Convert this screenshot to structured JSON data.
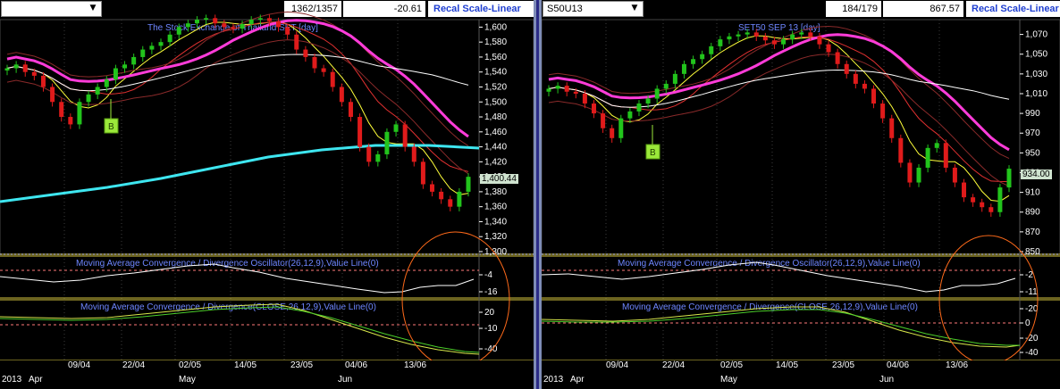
{
  "panes": [
    {
      "header": {
        "symbol": "",
        "ratio": "1362/1357",
        "change": "-20.61",
        "recal_label": "Recal Scale-Linear"
      },
      "price_title": "The Stock Exchange of Thailand SET [day]",
      "macd_osc_title": "Moving Average Convergence / Divergence Oscillator(26,12,9),Value Line(0)",
      "macd_title": "Moving Average Convergence / Divergence(CLOSE,26,12,9),Value Line(0)",
      "last_price": "1,400.44",
      "marker": "B",
      "price_ticks": [
        "1,600",
        "1,580",
        "1,560",
        "1,540",
        "1,520",
        "1,500",
        "1,480",
        "1,460",
        "1,440",
        "1,420",
        "1,400",
        "1,380",
        "1,360",
        "1,340",
        "1,320",
        "1,300"
      ],
      "osc_ticks": [
        "-4",
        "-16"
      ],
      "macd_ticks": [
        "20",
        "-10",
        "-40"
      ],
      "date_labels": [
        "09/04",
        "22/04",
        "02/05",
        "14/05",
        "23/05",
        "04/06",
        "13/06"
      ],
      "month_labels": [
        "2013",
        "Apr",
        "May",
        "Jun"
      ]
    },
    {
      "header": {
        "symbol": "S50U13",
        "ratio": "184/179",
        "change": "867.57",
        "recal_label": "Recal Scale-Linear"
      },
      "price_title": "SET50 SEP 13 [day]",
      "macd_osc_title": "Moving Average Convergence / Divergence Oscillator(26,12,9),Value Line(0)",
      "macd_title": "Moving Average Convergence / Divergence(CLOSE,26,12,9),Value Line(0)",
      "last_price": "934.00",
      "marker": "B",
      "price_ticks": [
        "1,070",
        "1,050",
        "1,030",
        "1,010",
        "990",
        "970",
        "950",
        "930",
        "910",
        "890",
        "870",
        "850"
      ],
      "osc_ticks": [
        "-2",
        "-11",
        "-20"
      ],
      "macd_ticks": [
        "0",
        "-20",
        "-40"
      ],
      "date_labels": [
        "09/04",
        "22/04",
        "02/05",
        "14/05",
        "23/05",
        "04/06",
        "13/06"
      ],
      "month_labels": [
        "2013",
        "Apr",
        "May",
        "Jun"
      ]
    }
  ],
  "chart_data": [
    {
      "type": "candlestick",
      "title": "The Stock Exchange of Thailand SET [day]",
      "ylim": [
        1300,
        1610
      ],
      "closes": [
        1545,
        1550,
        1540,
        1535,
        1520,
        1500,
        1480,
        1470,
        1500,
        1510,
        1520,
        1530,
        1545,
        1550,
        1560,
        1570,
        1575,
        1580,
        1590,
        1600,
        1605,
        1610,
        1612,
        1605,
        1600,
        1598,
        1604,
        1610,
        1612,
        1608,
        1600,
        1590,
        1570,
        1560,
        1545,
        1540,
        1520,
        1500,
        1480,
        1440,
        1420,
        1430,
        1460,
        1470,
        1440,
        1420,
        1390,
        1380,
        1370,
        1360,
        1380,
        1400
      ],
      "colors": {
        "up": "#22c41c",
        "down": "#e01b1b",
        "ma_fast": "#ffff3a",
        "ma_mid": "#e03030",
        "ma_pink": "#ff3cd9",
        "ma_white": "#ffffff",
        "ma_cyan": "#3ee6f0"
      }
    },
    {
      "type": "candlestick",
      "title": "SET50 SEP 13 [day]",
      "ylim": [
        850,
        1085
      ],
      "closes": [
        1015,
        1018,
        1012,
        1010,
        1000,
        990,
        975,
        965,
        985,
        992,
        1000,
        1005,
        1015,
        1020,
        1030,
        1040,
        1045,
        1050,
        1058,
        1065,
        1068,
        1070,
        1072,
        1068,
        1064,
        1060,
        1065,
        1070,
        1072,
        1068,
        1060,
        1052,
        1040,
        1030,
        1020,
        1015,
        1000,
        985,
        965,
        940,
        920,
        935,
        955,
        960,
        935,
        920,
        905,
        900,
        895,
        890,
        915,
        934
      ]
    }
  ]
}
